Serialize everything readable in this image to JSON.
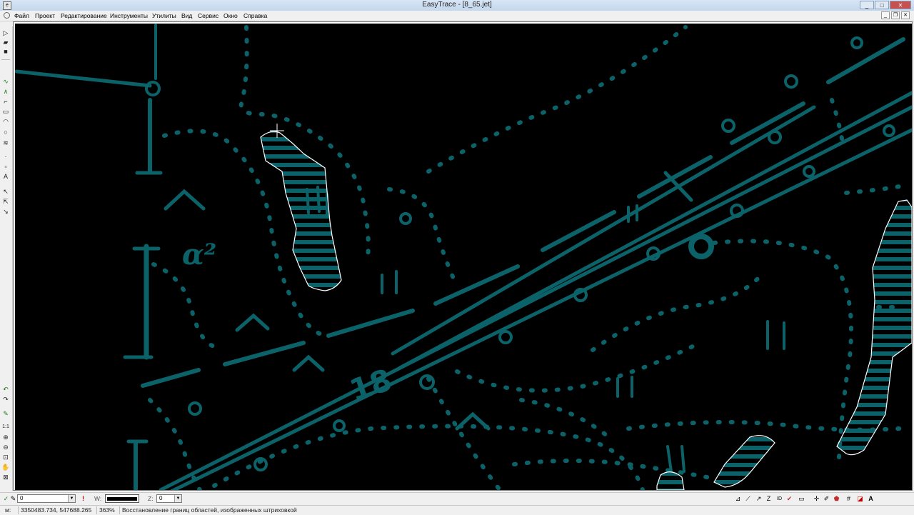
{
  "window": {
    "title": "EasyTrace - [8_65.jet]",
    "controls": [
      "minimize",
      "maximize",
      "close"
    ]
  },
  "menubar": {
    "items": [
      "Файл",
      "Проект",
      "Редактирование",
      "Инструменты",
      "Утилиты",
      "Вид",
      "Сервис",
      "Окно",
      "Справка"
    ]
  },
  "left_toolbar": {
    "tools": [
      "new-file-icon",
      "open-file-icon",
      "save-icon",
      "polyline-icon",
      "polyline-alt-icon",
      "step-line-icon",
      "rectangle-icon",
      "arc-icon",
      "circle-icon",
      "hatch-icon",
      "point-icon",
      "square-point-icon",
      "text-tool-icon",
      "pointer-icon",
      "multi-select-icon",
      "node-select-icon",
      "undo-icon",
      "redo-icon",
      "pen-icon",
      "scale-1-1-icon",
      "zoom-in-icon",
      "zoom-out-icon",
      "zoom-window-icon",
      "pan-icon",
      "zoom-fit-icon"
    ]
  },
  "bottom_toolbar": {
    "layer_value": "0",
    "width_label": "W:",
    "z_label": "Z:",
    "z_value": "0",
    "line_color": "#000000"
  },
  "statusbar": {
    "units": "м:",
    "coordinates": "3350483.734, 547688.265",
    "zoom": "363%",
    "message": "Восстановление границ областей, изображенных штриховкой"
  },
  "map": {
    "background": "#000000",
    "feature_color": "#0b6369",
    "outline_color": "#ffffff",
    "labels": [
      "α²",
      "18"
    ]
  }
}
